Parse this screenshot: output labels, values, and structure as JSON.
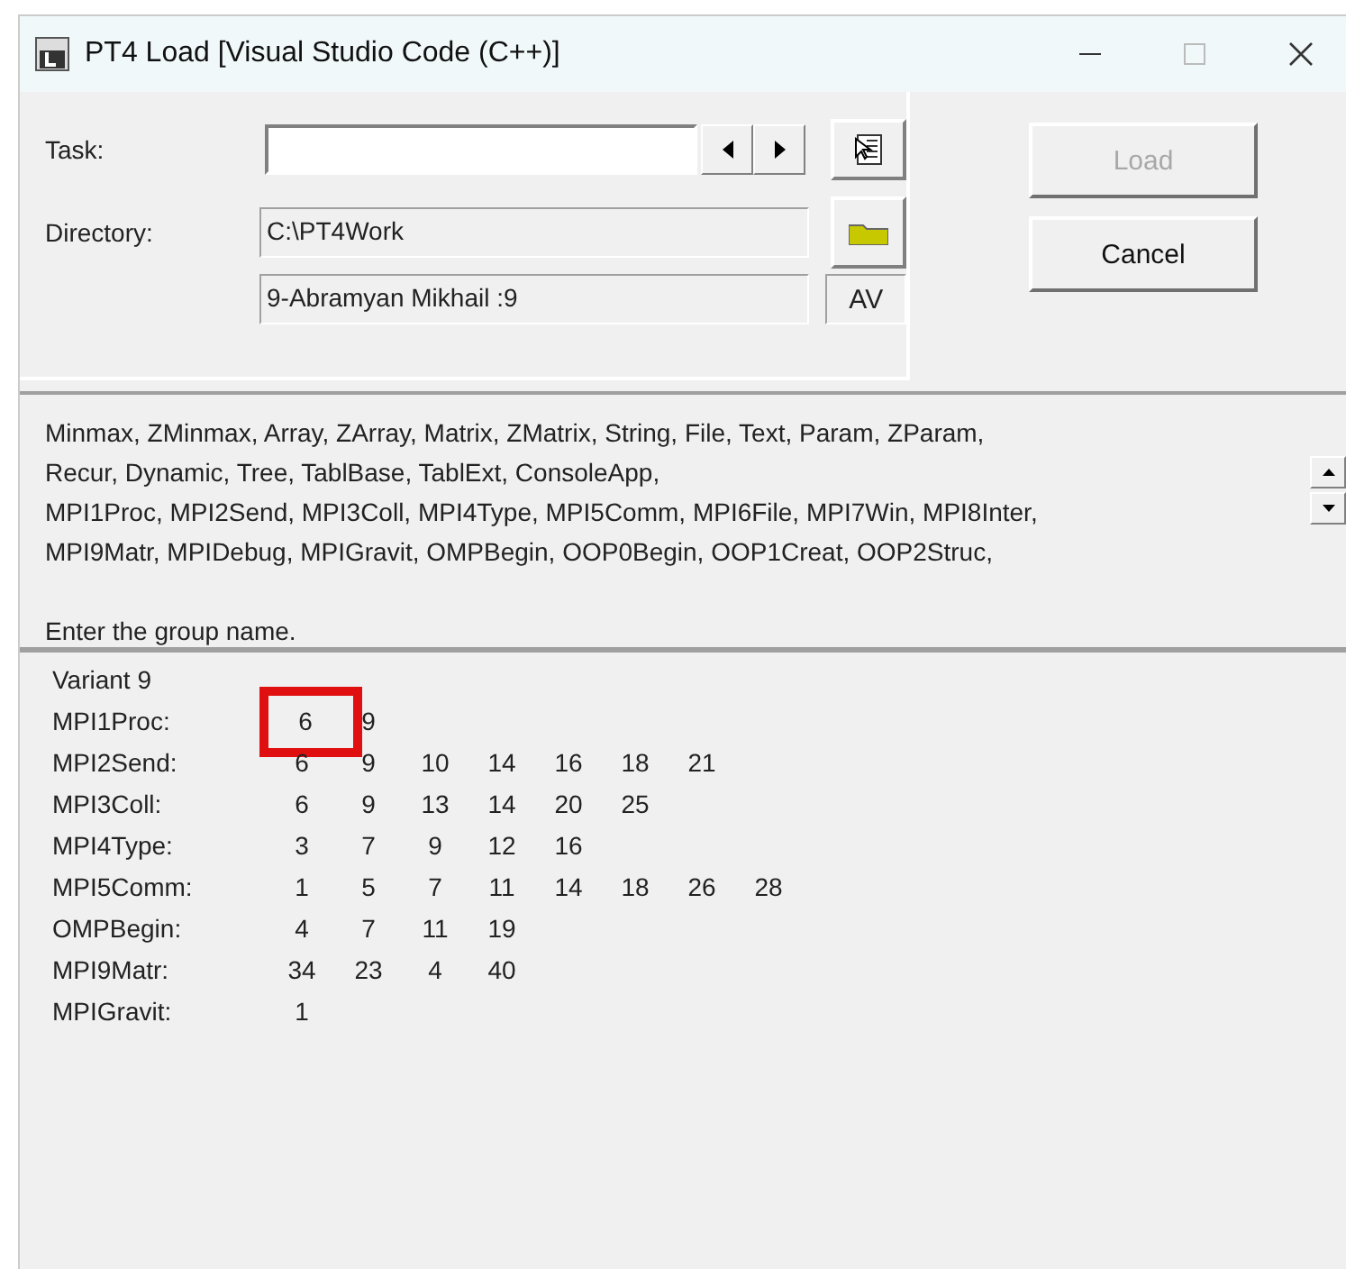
{
  "window": {
    "title": "PT4 Load [Visual Studio Code (C++)]"
  },
  "task": {
    "label": "Task:"
  },
  "directory": {
    "label": "Directory:",
    "value": "C:\\PT4Work"
  },
  "student": {
    "value": "9-Abramyan Mikhail :9",
    "badge": "AV"
  },
  "buttons": [
    {
      "label": "Load",
      "disabled": true
    },
    {
      "label": "Cancel",
      "disabled": false
    }
  ],
  "groups_text": [
    "Minmax, ZMinmax, Array, ZArray, Matrix, ZMatrix, String, File, Text, Param, ZParam,",
    "Recur, Dynamic, Tree, TablBase, TablExt, ConsoleApp,",
    "MPI1Proc, MPI2Send, MPI3Coll, MPI4Type, MPI5Comm, MPI6File, MPI7Win, MPI8Inter,",
    "MPI9Matr, MPIDebug, MPIGravit, OMPBegin, OOP0Begin, OOP1Creat, OOP2Struc,"
  ],
  "hint": "Enter the group name.",
  "variant": {
    "title": "Variant 9",
    "rows": [
      {
        "group": "MPI1Proc:",
        "tasks": [
          {
            "n": "6",
            "highlighted": true
          },
          {
            "n": "9",
            "highlighted": false
          }
        ]
      },
      {
        "group": "MPI2Send:",
        "tasks": [
          {
            "n": "6",
            "highlighted": false
          },
          {
            "n": "9",
            "highlighted": false
          },
          {
            "n": "10",
            "highlighted": false
          },
          {
            "n": "14",
            "highlighted": false
          },
          {
            "n": "16",
            "highlighted": false
          },
          {
            "n": "18",
            "highlighted": false
          },
          {
            "n": "21",
            "highlighted": false
          }
        ]
      },
      {
        "group": "MPI3Coll:",
        "tasks": [
          {
            "n": "6",
            "highlighted": false
          },
          {
            "n": "9",
            "highlighted": false
          },
          {
            "n": "13",
            "highlighted": false
          },
          {
            "n": "14",
            "highlighted": false
          },
          {
            "n": "20",
            "highlighted": false
          },
          {
            "n": "25",
            "highlighted": false
          }
        ]
      },
      {
        "group": "MPI4Type:",
        "tasks": [
          {
            "n": "3",
            "highlighted": false
          },
          {
            "n": "7",
            "highlighted": false
          },
          {
            "n": "9",
            "highlighted": false
          },
          {
            "n": "12",
            "highlighted": false
          },
          {
            "n": "16",
            "highlighted": false
          }
        ]
      },
      {
        "group": "MPI5Comm:",
        "tasks": [
          {
            "n": "1",
            "highlighted": false
          },
          {
            "n": "5",
            "highlighted": false
          },
          {
            "n": "7",
            "highlighted": false
          },
          {
            "n": "11",
            "highlighted": false
          },
          {
            "n": "14",
            "highlighted": false
          },
          {
            "n": "18",
            "highlighted": false
          },
          {
            "n": "26",
            "highlighted": false
          },
          {
            "n": "28",
            "highlighted": false
          }
        ]
      },
      {
        "group": "OMPBegin:",
        "tasks": [
          {
            "n": "4",
            "highlighted": false
          },
          {
            "n": "7",
            "highlighted": false
          },
          {
            "n": "11",
            "highlighted": false
          },
          {
            "n": "19",
            "highlighted": false
          }
        ]
      },
      {
        "group": "MPI9Matr:",
        "tasks": [
          {
            "n": "34",
            "highlighted": false
          },
          {
            "n": "23",
            "highlighted": false
          },
          {
            "n": "4",
            "highlighted": false
          },
          {
            "n": "40",
            "highlighted": false
          }
        ]
      },
      {
        "group": "MPIGravit:",
        "tasks": [
          {
            "n": "1",
            "highlighted": false
          }
        ]
      }
    ]
  }
}
